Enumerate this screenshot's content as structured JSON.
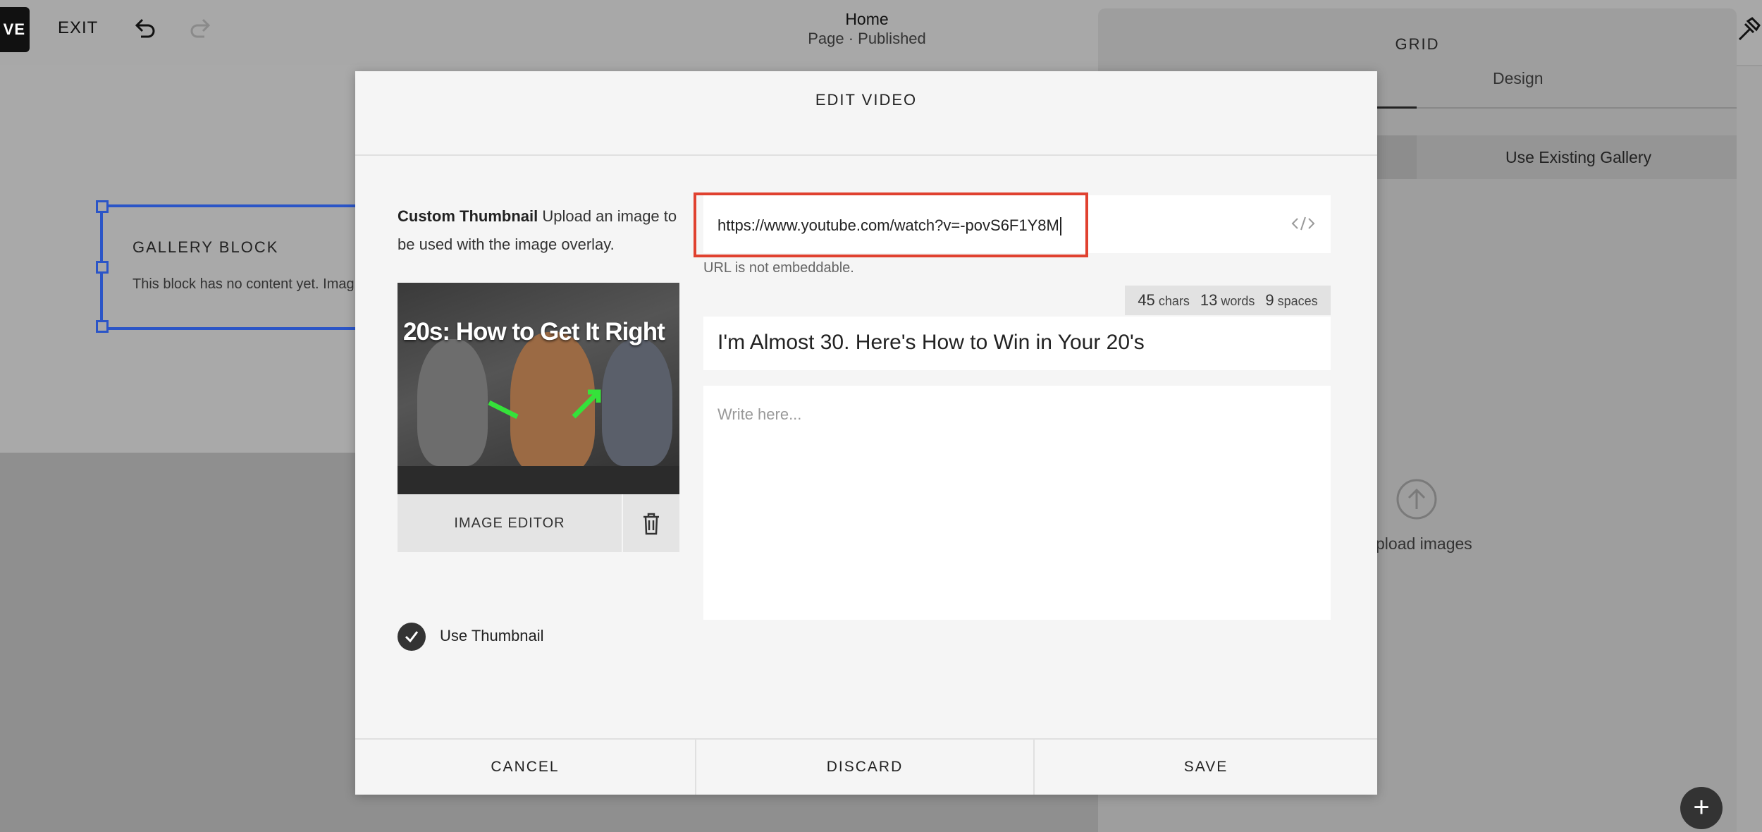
{
  "topbar": {
    "save_label": "VE",
    "exit_label": "EXIT",
    "page_title": "Home",
    "page_status": "Page · Published"
  },
  "canvas": {
    "gallery_title": "GALLERY BLOCK",
    "gallery_text": "This block has no content yet. Imag"
  },
  "side_panel": {
    "title": "GRID",
    "tab_design": "Design",
    "existing_gallery": "Use Existing Gallery",
    "upload_text": "pload images",
    "add_symbol": "+"
  },
  "modal": {
    "title": "EDIT VIDEO",
    "thumb_help_bold": "Custom Thumbnail",
    "thumb_help_text": " Upload an image to be used with the image overlay.",
    "thumb_caption": "20s: How to Get It Right",
    "image_editor_label": "IMAGE EDITOR",
    "use_thumbnail_label": "Use Thumbnail",
    "use_thumbnail_checked": true,
    "url_value": "https://www.youtube.com/watch?v=-povS6F1Y8M",
    "url_error": "URL is not embeddable.",
    "counts": {
      "chars": "45",
      "chars_label": "chars",
      "words": "13",
      "words_label": "words",
      "spaces": "9",
      "spaces_label": "spaces"
    },
    "video_title": "I'm Almost 30. Here's How to Win in Your 20's",
    "description_placeholder": "Write here...",
    "cancel_label": "CANCEL",
    "discard_label": "DISCARD",
    "save_label": "SAVE"
  },
  "colors": {
    "highlight": "#e0412f",
    "selection": "#2b55c7"
  }
}
